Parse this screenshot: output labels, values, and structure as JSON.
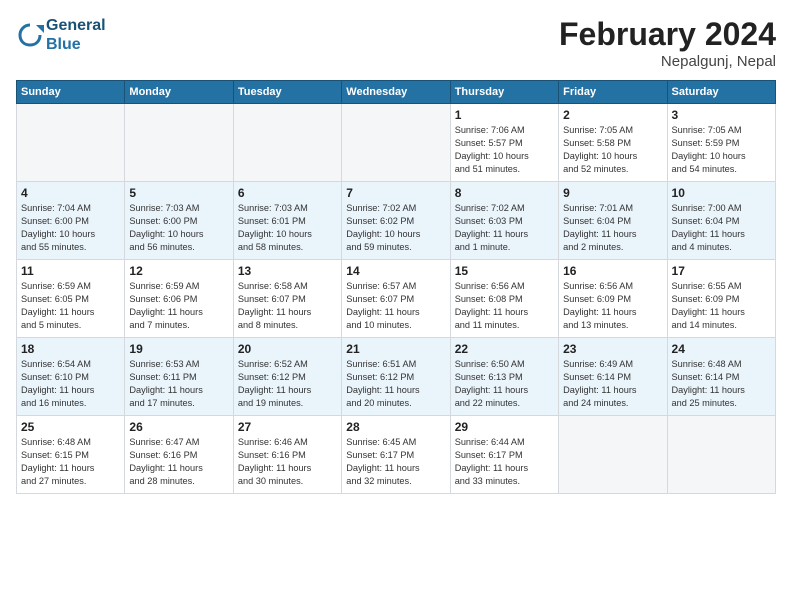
{
  "header": {
    "logo_line1": "General",
    "logo_line2": "Blue",
    "month": "February 2024",
    "location": "Nepalgunj, Nepal"
  },
  "weekdays": [
    "Sunday",
    "Monday",
    "Tuesday",
    "Wednesday",
    "Thursday",
    "Friday",
    "Saturday"
  ],
  "weeks": [
    [
      {
        "day": "",
        "info": ""
      },
      {
        "day": "",
        "info": ""
      },
      {
        "day": "",
        "info": ""
      },
      {
        "day": "",
        "info": ""
      },
      {
        "day": "1",
        "info": "Sunrise: 7:06 AM\nSunset: 5:57 PM\nDaylight: 10 hours\nand 51 minutes."
      },
      {
        "day": "2",
        "info": "Sunrise: 7:05 AM\nSunset: 5:58 PM\nDaylight: 10 hours\nand 52 minutes."
      },
      {
        "day": "3",
        "info": "Sunrise: 7:05 AM\nSunset: 5:59 PM\nDaylight: 10 hours\nand 54 minutes."
      }
    ],
    [
      {
        "day": "4",
        "info": "Sunrise: 7:04 AM\nSunset: 6:00 PM\nDaylight: 10 hours\nand 55 minutes."
      },
      {
        "day": "5",
        "info": "Sunrise: 7:03 AM\nSunset: 6:00 PM\nDaylight: 10 hours\nand 56 minutes."
      },
      {
        "day": "6",
        "info": "Sunrise: 7:03 AM\nSunset: 6:01 PM\nDaylight: 10 hours\nand 58 minutes."
      },
      {
        "day": "7",
        "info": "Sunrise: 7:02 AM\nSunset: 6:02 PM\nDaylight: 10 hours\nand 59 minutes."
      },
      {
        "day": "8",
        "info": "Sunrise: 7:02 AM\nSunset: 6:03 PM\nDaylight: 11 hours\nand 1 minute."
      },
      {
        "day": "9",
        "info": "Sunrise: 7:01 AM\nSunset: 6:04 PM\nDaylight: 11 hours\nand 2 minutes."
      },
      {
        "day": "10",
        "info": "Sunrise: 7:00 AM\nSunset: 6:04 PM\nDaylight: 11 hours\nand 4 minutes."
      }
    ],
    [
      {
        "day": "11",
        "info": "Sunrise: 6:59 AM\nSunset: 6:05 PM\nDaylight: 11 hours\nand 5 minutes."
      },
      {
        "day": "12",
        "info": "Sunrise: 6:59 AM\nSunset: 6:06 PM\nDaylight: 11 hours\nand 7 minutes."
      },
      {
        "day": "13",
        "info": "Sunrise: 6:58 AM\nSunset: 6:07 PM\nDaylight: 11 hours\nand 8 minutes."
      },
      {
        "day": "14",
        "info": "Sunrise: 6:57 AM\nSunset: 6:07 PM\nDaylight: 11 hours\nand 10 minutes."
      },
      {
        "day": "15",
        "info": "Sunrise: 6:56 AM\nSunset: 6:08 PM\nDaylight: 11 hours\nand 11 minutes."
      },
      {
        "day": "16",
        "info": "Sunrise: 6:56 AM\nSunset: 6:09 PM\nDaylight: 11 hours\nand 13 minutes."
      },
      {
        "day": "17",
        "info": "Sunrise: 6:55 AM\nSunset: 6:09 PM\nDaylight: 11 hours\nand 14 minutes."
      }
    ],
    [
      {
        "day": "18",
        "info": "Sunrise: 6:54 AM\nSunset: 6:10 PM\nDaylight: 11 hours\nand 16 minutes."
      },
      {
        "day": "19",
        "info": "Sunrise: 6:53 AM\nSunset: 6:11 PM\nDaylight: 11 hours\nand 17 minutes."
      },
      {
        "day": "20",
        "info": "Sunrise: 6:52 AM\nSunset: 6:12 PM\nDaylight: 11 hours\nand 19 minutes."
      },
      {
        "day": "21",
        "info": "Sunrise: 6:51 AM\nSunset: 6:12 PM\nDaylight: 11 hours\nand 20 minutes."
      },
      {
        "day": "22",
        "info": "Sunrise: 6:50 AM\nSunset: 6:13 PM\nDaylight: 11 hours\nand 22 minutes."
      },
      {
        "day": "23",
        "info": "Sunrise: 6:49 AM\nSunset: 6:14 PM\nDaylight: 11 hours\nand 24 minutes."
      },
      {
        "day": "24",
        "info": "Sunrise: 6:48 AM\nSunset: 6:14 PM\nDaylight: 11 hours\nand 25 minutes."
      }
    ],
    [
      {
        "day": "25",
        "info": "Sunrise: 6:48 AM\nSunset: 6:15 PM\nDaylight: 11 hours\nand 27 minutes."
      },
      {
        "day": "26",
        "info": "Sunrise: 6:47 AM\nSunset: 6:16 PM\nDaylight: 11 hours\nand 28 minutes."
      },
      {
        "day": "27",
        "info": "Sunrise: 6:46 AM\nSunset: 6:16 PM\nDaylight: 11 hours\nand 30 minutes."
      },
      {
        "day": "28",
        "info": "Sunrise: 6:45 AM\nSunset: 6:17 PM\nDaylight: 11 hours\nand 32 minutes."
      },
      {
        "day": "29",
        "info": "Sunrise: 6:44 AM\nSunset: 6:17 PM\nDaylight: 11 hours\nand 33 minutes."
      },
      {
        "day": "",
        "info": ""
      },
      {
        "day": "",
        "info": ""
      }
    ]
  ]
}
